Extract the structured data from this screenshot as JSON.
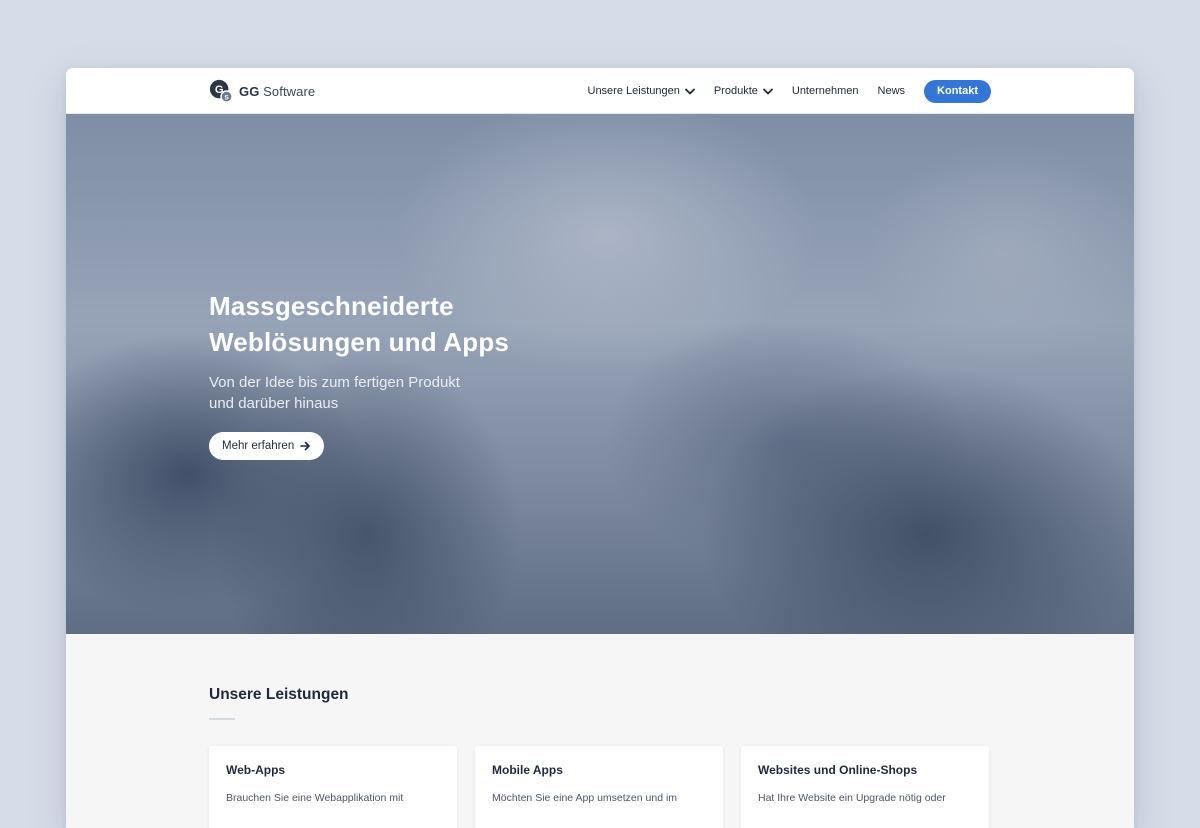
{
  "brand": {
    "name_bold": "GG",
    "name_light": "Software",
    "logo_letter": "G",
    "logo_badge_letter": "S"
  },
  "nav": {
    "items": [
      {
        "label": "Unsere Leistungen",
        "has_dropdown": true
      },
      {
        "label": "Produkte",
        "has_dropdown": true
      },
      {
        "label": "Unternehmen",
        "has_dropdown": false
      },
      {
        "label": "News",
        "has_dropdown": false
      }
    ],
    "cta_label": "Kontakt"
  },
  "hero": {
    "title_line1": "Massgeschneiderte",
    "title_line2": "Weblösungen und Apps",
    "subtitle_line1": "Von der Idee bis zum fertigen Produkt",
    "subtitle_line2": "und darüber hinaus",
    "button_label": "Mehr erfahren"
  },
  "services": {
    "heading": "Unsere Leistungen",
    "cards": [
      {
        "title": "Web-Apps",
        "text": "Brauchen Sie eine Webapplikation mit"
      },
      {
        "title": "Mobile Apps",
        "text": "Möchten Sie eine App umsetzen und im"
      },
      {
        "title": "Websites und Online-Shops",
        "text": "Hat Ihre Website ein Upgrade nötig oder"
      }
    ]
  },
  "colors": {
    "accent": "#3575d6",
    "page_bg": "#d7dde8",
    "hero_cloud": "#5f6d85"
  }
}
